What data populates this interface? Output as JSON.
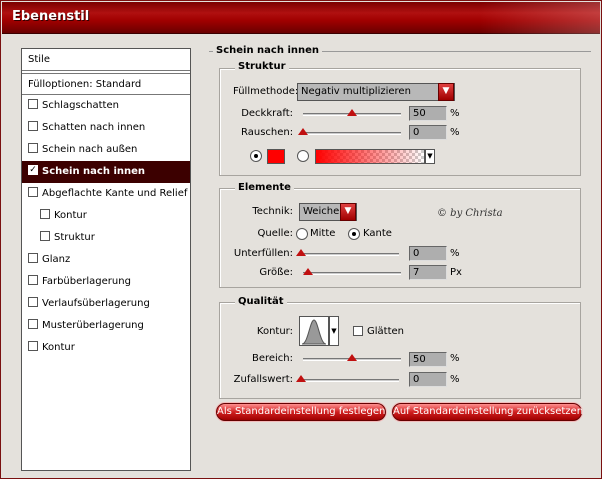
{
  "window": {
    "title": "Ebenenstil"
  },
  "stylelist": {
    "items": [
      {
        "label": "Stile",
        "checkbox": false,
        "checked": false,
        "selected": false,
        "indent": 0
      },
      {
        "label": "Fülloptionen: Standard",
        "checkbox": false,
        "checked": false,
        "selected": false,
        "indent": 0
      },
      {
        "label": "Schlagschatten",
        "checkbox": true,
        "checked": false,
        "selected": false,
        "indent": 0
      },
      {
        "label": "Schatten nach innen",
        "checkbox": true,
        "checked": false,
        "selected": false,
        "indent": 0
      },
      {
        "label": "Schein nach außen",
        "checkbox": true,
        "checked": false,
        "selected": false,
        "indent": 0
      },
      {
        "label": "Schein nach innen",
        "checkbox": true,
        "checked": true,
        "selected": true,
        "indent": 0
      },
      {
        "label": "Abgeflachte Kante und Relief",
        "checkbox": true,
        "checked": false,
        "selected": false,
        "indent": 0
      },
      {
        "label": "Kontur",
        "checkbox": true,
        "checked": false,
        "selected": false,
        "indent": 1
      },
      {
        "label": "Struktur",
        "checkbox": true,
        "checked": false,
        "selected": false,
        "indent": 1
      },
      {
        "label": "Glanz",
        "checkbox": true,
        "checked": false,
        "selected": false,
        "indent": 0
      },
      {
        "label": "Farbüberlagerung",
        "checkbox": true,
        "checked": false,
        "selected": false,
        "indent": 0
      },
      {
        "label": "Verlaufsüberlagerung",
        "checkbox": true,
        "checked": false,
        "selected": false,
        "indent": 0
      },
      {
        "label": "Musterüberlagerung",
        "checkbox": true,
        "checked": false,
        "selected": false,
        "indent": 0
      },
      {
        "label": "Kontur",
        "checkbox": true,
        "checked": false,
        "selected": false,
        "indent": 0
      }
    ]
  },
  "panel": {
    "title": "Schein nach innen",
    "struktur": {
      "title": "Struktur",
      "fuellmethode_label": "Füllmethode:",
      "fuellmethode_value": "Negativ multiplizieren",
      "deckkraft_label": "Deckkraft:",
      "deckkraft_value": "50",
      "deckkraft_percent": 50,
      "rauschen_label": "Rauschen:",
      "rauschen_value": "0",
      "rauschen_percent": 0,
      "percent": "%",
      "color": "#ff0000"
    },
    "elemente": {
      "title": "Elemente",
      "technik_label": "Technik:",
      "technik_value": "Weicher",
      "quelle_label": "Quelle:",
      "quelle_mitte": "Mitte",
      "quelle_kante": "Kante",
      "unterfuellen_label": "Unterfüllen:",
      "unterfuellen_value": "0",
      "unterfuellen_percent": 0,
      "groesse_label": "Größe:",
      "groesse_value": "7",
      "groesse_unit": "Px",
      "percent": "%"
    },
    "qualitaet": {
      "title": "Qualität",
      "kontur_label": "Kontur:",
      "glaetten_label": "Glätten",
      "bereich_label": "Bereich:",
      "bereich_value": "50",
      "bereich_percent": 50,
      "zufallswert_label": "Zufallswert:",
      "zufallswert_value": "0",
      "zufallswert_percent": 0,
      "percent": "%"
    },
    "buttons": {
      "set_default": "Als Standardeinstellung festlegen",
      "reset_default": "Auf Standardeinstellung zurücksetzen"
    },
    "watermark": "© by Christa"
  },
  "colors": {
    "title_red": "#a00000",
    "selected_bg": "#3c0000",
    "accent": "#c01010"
  }
}
